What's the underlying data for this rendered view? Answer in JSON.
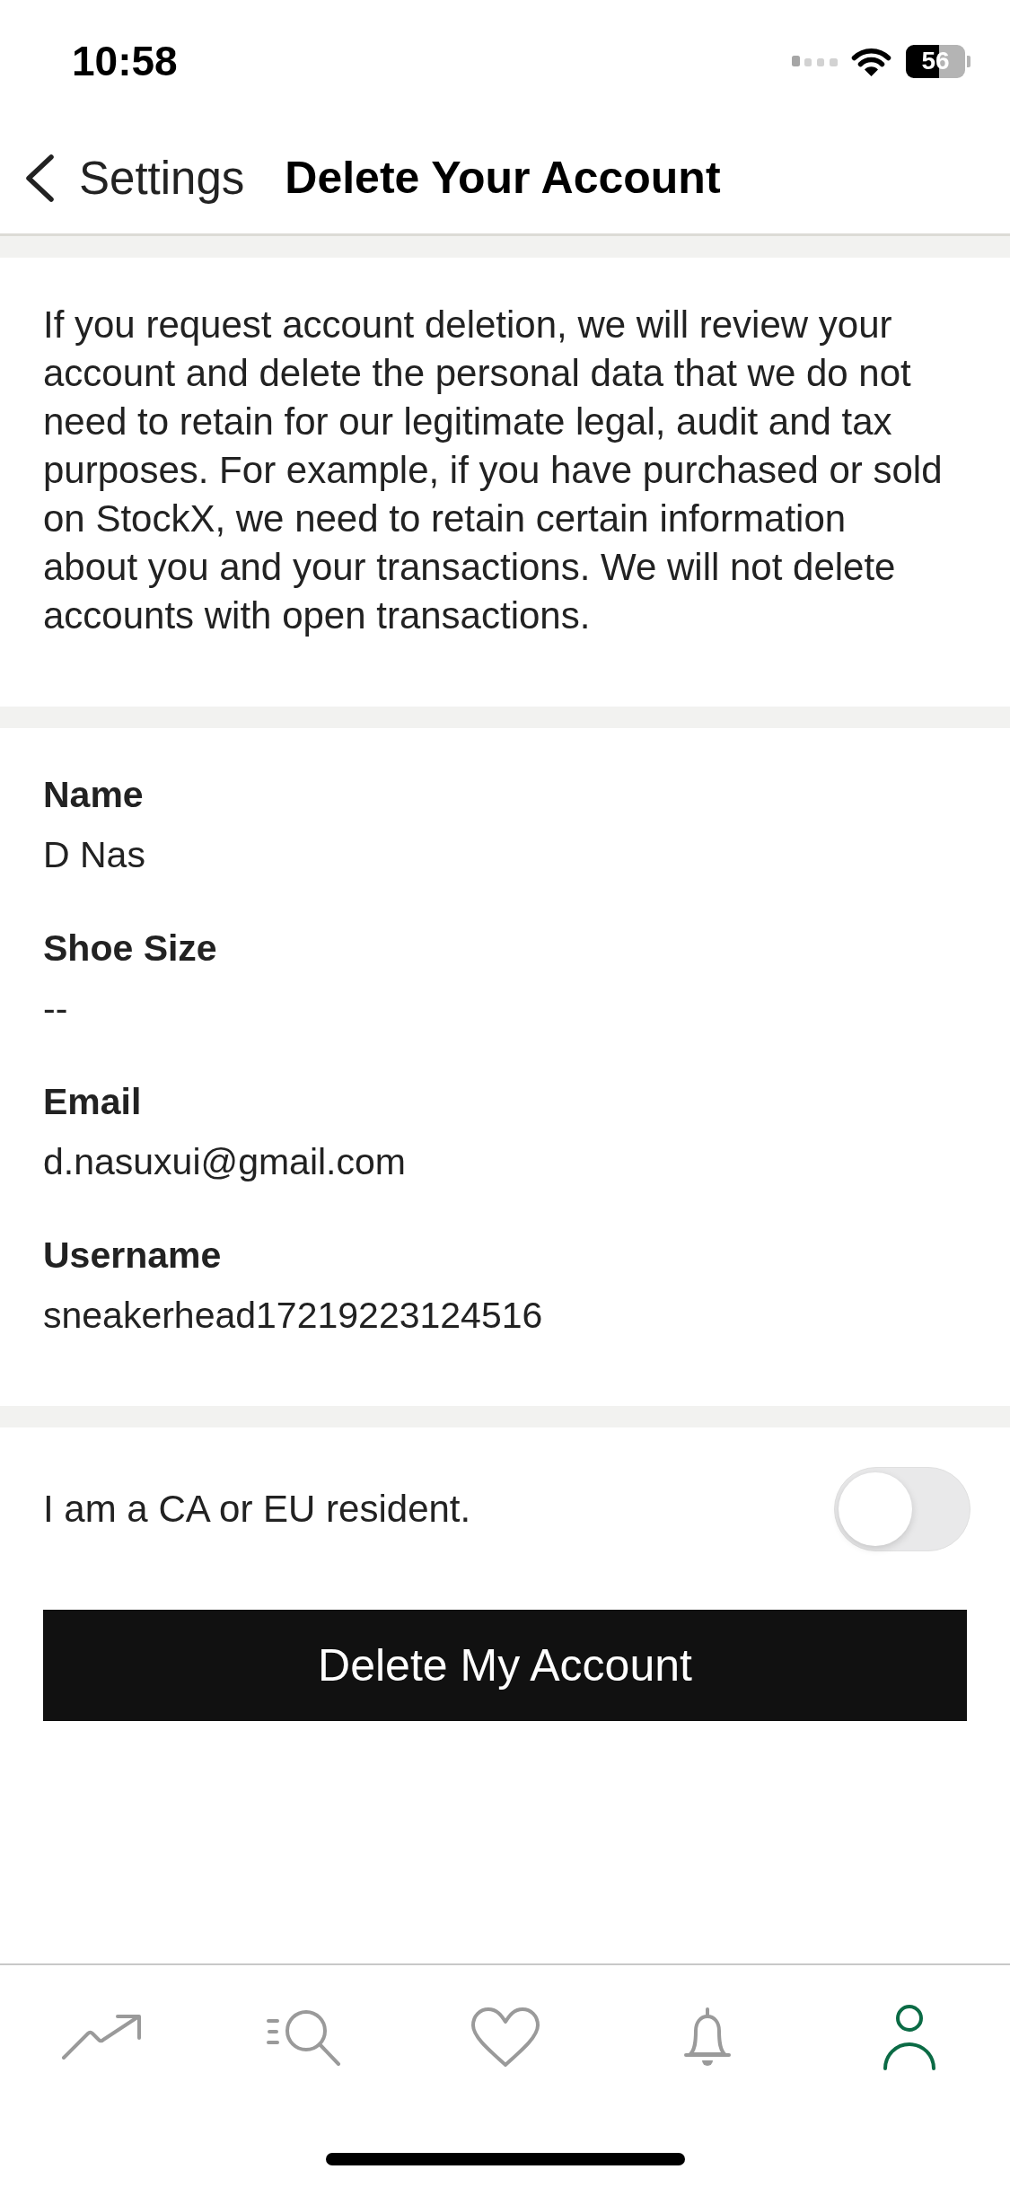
{
  "status_bar": {
    "time": "10:58",
    "battery": "56"
  },
  "nav_bar": {
    "back_label": "Settings",
    "title": "Delete Your Account"
  },
  "notice": "If you request account deletion, we will review your account and delete the personal data that we do not need to retain for our legitimate legal, audit and tax purposes. For example, if you have purchased or sold on StockX, we need to retain certain information about you and your transactions. We will not delete accounts with open transactions.",
  "details": [
    {
      "label": "Name",
      "value": "D Nas"
    },
    {
      "label": "Shoe Size",
      "value": "--"
    },
    {
      "label": "Email",
      "value": "d.nasuxui@gmail.com"
    },
    {
      "label": "Username",
      "value": "sneakerhead17219223124516"
    }
  ],
  "resident_toggle": {
    "label": "I am a CA or EU resident.",
    "on": false
  },
  "delete_button": {
    "label": "Delete My Account"
  },
  "tab_bar": [
    {
      "kind": "trending",
      "selected": false
    },
    {
      "kind": "search",
      "selected": false
    },
    {
      "kind": "favorites",
      "selected": false
    },
    {
      "kind": "notifications",
      "selected": false
    },
    {
      "kind": "profile",
      "selected": true
    }
  ]
}
